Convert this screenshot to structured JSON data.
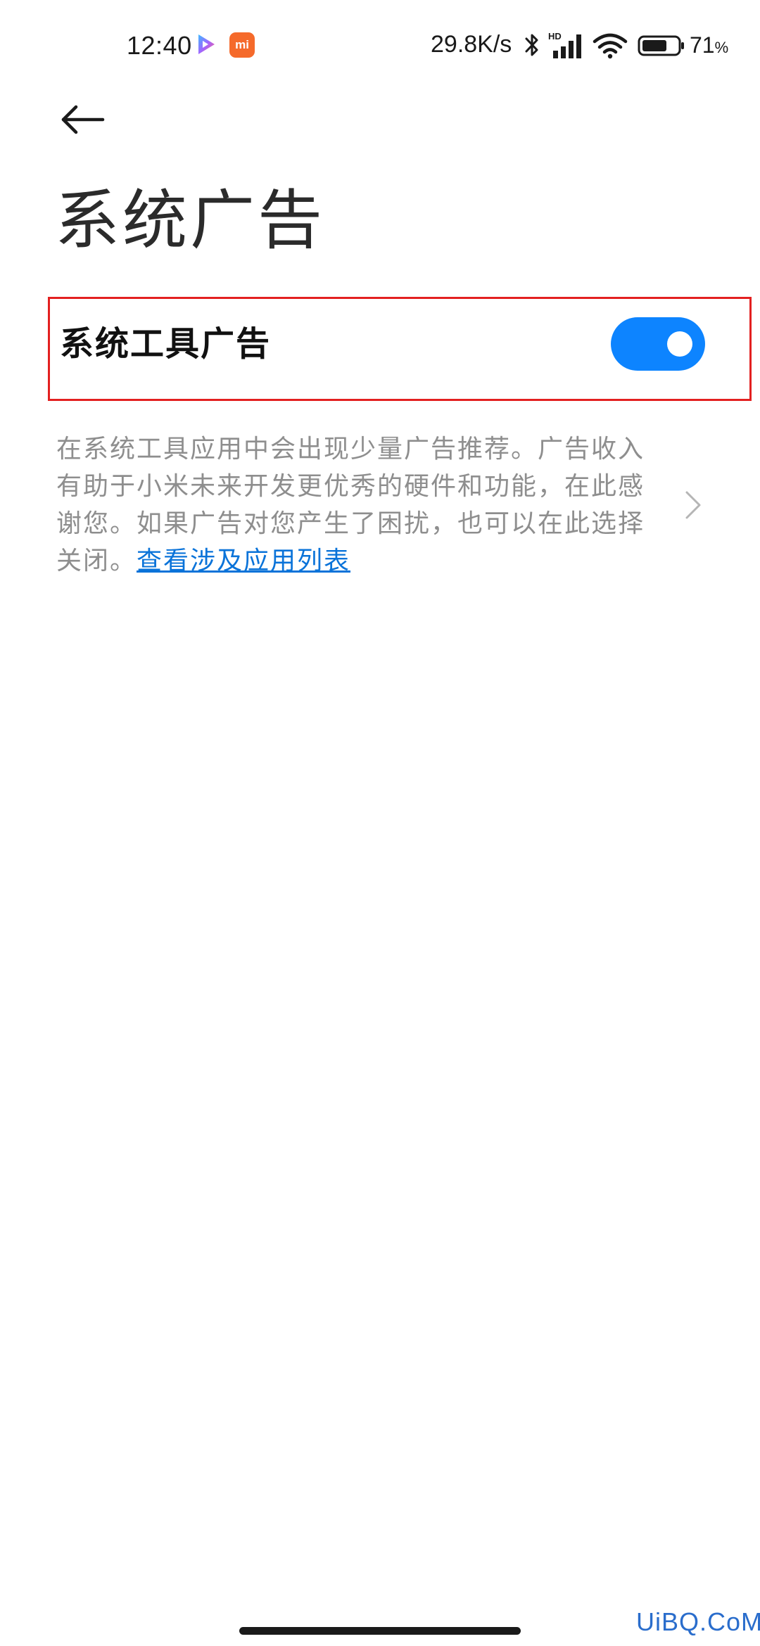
{
  "status_bar": {
    "time": "12:40",
    "mi_icon_label": "mi",
    "network_speed": "29.8K/s",
    "signal_badge": "HD",
    "battery_percent": "71",
    "battery_unit": "%",
    "battery_level": 0.71
  },
  "header": {
    "back_icon": "arrow-left-icon",
    "title": "系统广告"
  },
  "setting": {
    "label": "系统工具广告",
    "enabled": true,
    "toggle_color": "#0d84ff",
    "highlight_color": "#e32020"
  },
  "description": {
    "text": "在系统工具应用中会出现少量广告推荐。广告收入有助于小米未来开发更优秀的硬件和功能，在此感谢您。如果广告对您产生了困扰，也可以在此选择关闭。",
    "link_text": "查看涉及应用列表",
    "link_color": "#0a73d9"
  },
  "watermark": "UiBQ.CoM"
}
